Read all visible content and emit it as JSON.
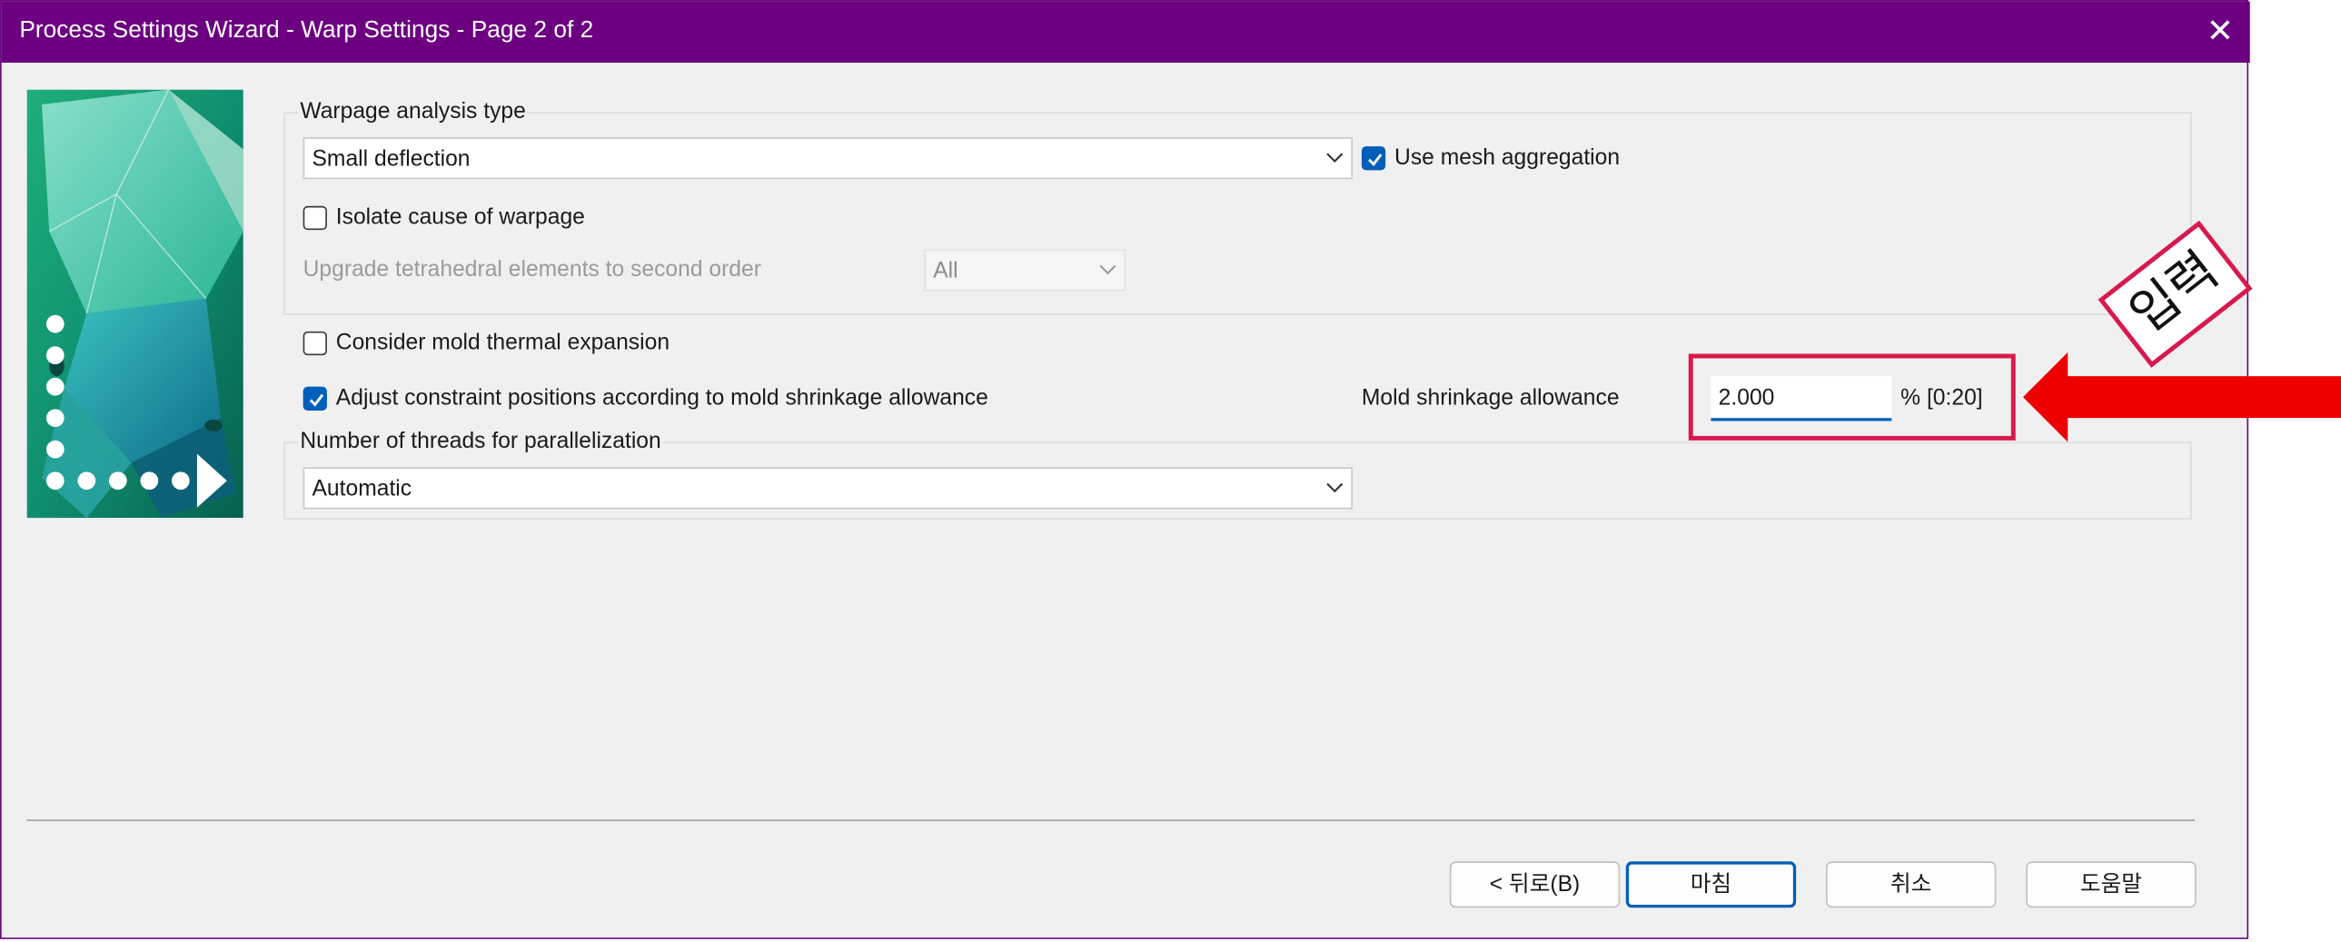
{
  "window": {
    "title": "Process Settings Wizard - Warp Settings - Page 2 of 2",
    "close_icon": "close-icon",
    "title_bar_color": "#6c0081"
  },
  "warpage_group": {
    "label": "Warpage analysis type",
    "analysis_type_value": "Small deflection",
    "use_mesh_aggregation": {
      "label": "Use mesh aggregation",
      "checked": true
    },
    "isolate_cause": {
      "label": "Isolate cause of warpage",
      "checked": false
    },
    "upgrade_tetra_label": "Upgrade tetrahedral elements to second order",
    "upgrade_tetra_value": "All"
  },
  "mold_section": {
    "thermal_expansion": {
      "label": "Consider mold thermal expansion",
      "checked": false
    },
    "adjust_constraint": {
      "label": "Adjust constraint positions according to mold shrinkage allowance",
      "checked": true
    },
    "shrinkage_label": "Mold shrinkage allowance",
    "shrinkage_value": "2.000",
    "shrinkage_unit": "% [0:20]"
  },
  "threads_group": {
    "label": "Number of threads for parallelization",
    "value": "Automatic"
  },
  "buttons": {
    "back": "< 뒤로(B)",
    "finish": "마침",
    "cancel": "취소",
    "help": "도움말"
  },
  "annotation": {
    "stamp_text": "입력",
    "accent_color": "#d8194e",
    "arrow_color": "#ee0000"
  },
  "colors": {
    "checkbox_checked": "#005fb8",
    "dialog_background": "#f0f0f0"
  }
}
